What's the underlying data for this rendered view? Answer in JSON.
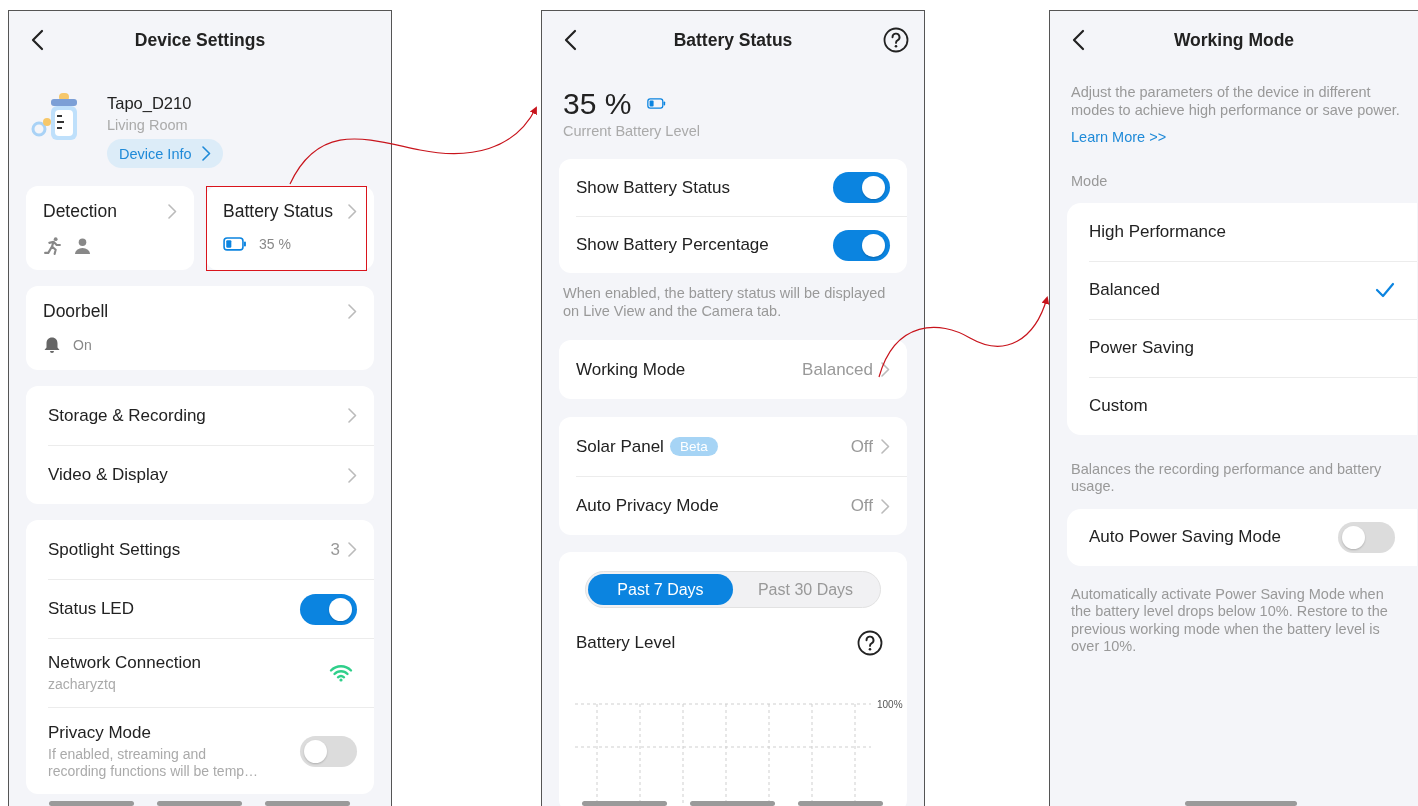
{
  "device_settings": {
    "title": "Device Settings",
    "device": {
      "name": "Tapo_D210",
      "room": "Living Room",
      "info_button": "Device Info"
    },
    "detection": {
      "title": "Detection"
    },
    "battery": {
      "title": "Battery Status",
      "reading": "35 %",
      "level": 0.35,
      "highlighted": true
    },
    "doorbell": {
      "title": "Doorbell",
      "status": "On"
    },
    "storage_rows": [
      {
        "kind": "link",
        "label": "Storage & Recording"
      },
      {
        "kind": "link",
        "label": "Video & Display"
      }
    ],
    "settings_rows": [
      {
        "kind": "link",
        "label": "Spotlight Settings",
        "value": "3"
      },
      {
        "kind": "toggle",
        "label": "Status LED",
        "on": true
      },
      {
        "kind": "network",
        "label": "Network Connection",
        "sub": "zacharyztq"
      },
      {
        "kind": "toggle",
        "label": "Privacy Mode",
        "sub": "If enabled, streaming and recording functions will be temp…",
        "on": false
      }
    ]
  },
  "battery_status": {
    "title": "Battery Status",
    "percent": "35 %",
    "level": 0.35,
    "caption": "Current Battery Level",
    "toggles": [
      {
        "label": "Show Battery Status",
        "on": true
      },
      {
        "label": "Show Battery Percentage",
        "on": true
      }
    ],
    "note": "When enabled, the battery status will be displayed on Live View and the Camera tab.",
    "working_mode": {
      "label": "Working Mode",
      "value": "Balanced"
    },
    "features": [
      {
        "label": "Solar Panel",
        "badge": "Beta",
        "value": "Off"
      },
      {
        "label": "Auto Privacy Mode",
        "value": "Off"
      }
    ],
    "range_tabs": [
      {
        "label": "Past 7 Days",
        "selected": true
      },
      {
        "label": "Past 30 Days",
        "selected": false
      }
    ],
    "chart": {
      "title": "Battery Level",
      "axis_label": "100%"
    }
  },
  "working_mode": {
    "title": "Working Mode",
    "intro": "Adjust the parameters of the device in different modes to achieve high performance or save power.",
    "link": "Learn More >>",
    "section_label": "Mode",
    "modes": [
      {
        "label": "High Performance",
        "selected": false
      },
      {
        "label": "Balanced",
        "selected": true
      },
      {
        "label": "Power Saving",
        "selected": false
      },
      {
        "label": "Custom",
        "selected": false
      }
    ],
    "description": "Balances the recording performance and battery usage.",
    "auto_power_saving": {
      "label": "Auto Power Saving Mode",
      "on": false
    },
    "footnote": "Automatically activate Power Saving Mode when the battery level drops below 10%. Restore to the previous working mode when the battery level is over 10%."
  }
}
